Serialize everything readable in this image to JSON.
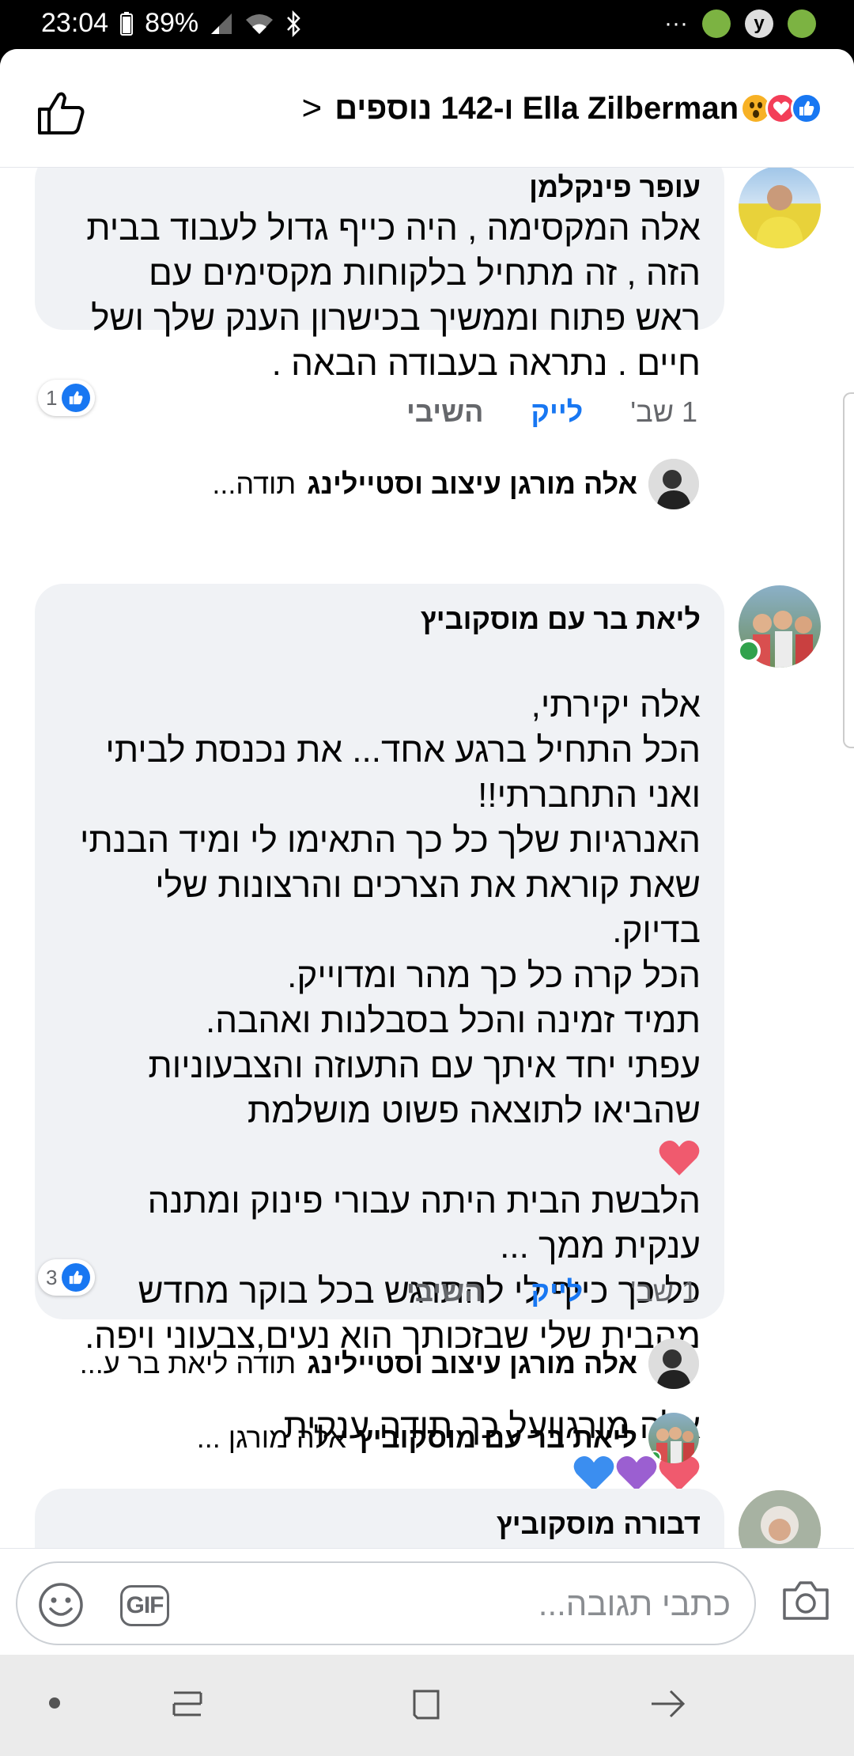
{
  "status_bar": {
    "time": "23:04",
    "battery": "89%"
  },
  "header": {
    "title": "Ella Zilberman ו-142 נוספים",
    "reactions": [
      "like-icon",
      "love-icon",
      "wow-icon"
    ]
  },
  "comments": [
    {
      "author": "עופר פינקלמן",
      "text": "אלה המקסימה , היה כייף גדול לעבוד בבית\nהזה , זה מתחיל בלקוחות מקסימים עם\nראש פתוח וממשיך בכישרון הענק שלך ושל\nחיים . נתראה בעבודה הבאה .",
      "time": "1 שב'",
      "like_label": "לייק",
      "reply_label": "השיבי",
      "reaction_count": "1",
      "reply_preview": {
        "author": "אלה מורגן עיצוב וסטיילינג",
        "text": "תודה..."
      }
    },
    {
      "author": "ליאת בר עם מוסקוביץ",
      "text": "אלה יקירתי,\nהכל התחיל ברגע אחד... את נכנסת לביתי\nואני התחברתי!!\nהאנרגיות שלך כל כך התאימו לי ומיד הבנתי\nשאת קוראת את הצרכים והרצונות שלי\nבדיוק.\nהכל קרה כל כך מהר ומדוייק.\nתמיד זמינה והכל בסבלנות ואהבה.\nעפתי יחד איתך עם התעוזה והצבעוניות\nשהביאו לתוצאה פשוט מושלמת",
      "text2": "הלבשת הבית היתה עבורי פינוק ומתנה\nענקית ממך ...\nכל כך כייף לי להתרגש בכל בוקר מחדש\nמהבית שלי שבזכותך הוא נעים,צבעוני ויפה.",
      "text3": "אלה מורגןועל כך תודה ענקית",
      "time": "1 שב'",
      "like_label": "לייק",
      "reply_label": "השיבי",
      "reaction_count": "3",
      "replies": [
        {
          "author": "אלה מורגן עיצוב וסטיילינג",
          "text": "תודה ליאת בר ע..."
        },
        {
          "author": "ליאת בר עם מוסקוביץ",
          "text": "אלה מורגן ..."
        }
      ]
    },
    {
      "author": "דבורה מוסקוביץ"
    }
  ],
  "composer": {
    "placeholder": "כתבי תגובה...",
    "gif_label": "GIF"
  },
  "colors": {
    "accent": "#1877f2",
    "bubble": "#f0f2f5",
    "love": "#f33e58",
    "purple_heart": "#9b5fd1",
    "blue_heart": "#3b8ef0"
  }
}
